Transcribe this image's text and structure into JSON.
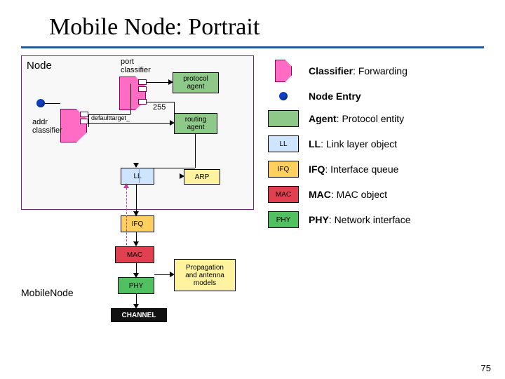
{
  "title": "Mobile Node: Portrait",
  "page_number": "75",
  "diagram": {
    "node_label": "Node",
    "port_classifier_label": "port\nclassifier",
    "protocol_agent": "protocol\nagent",
    "addr_classifier_label": "addr\nclassifier",
    "default_target": "defaulttarget_",
    "routing_agent": "routing\nagent",
    "num255": "255",
    "ll": "LL",
    "arp": "ARP",
    "ifq": "IFQ",
    "mac": "MAC",
    "phy": "PHY",
    "mobilenode": "MobileNode",
    "channel": "CHANNEL",
    "propagation": "Propagation\nand antenna\nmodels"
  },
  "legend": {
    "classifier": {
      "term": "Classifier",
      "desc": ": Forwarding"
    },
    "entry": {
      "term": "Node Entry",
      "desc": ""
    },
    "agent": {
      "term": "Agent",
      "desc": ": Protocol entity"
    },
    "ll": {
      "icon": "LL",
      "term": "LL",
      "desc": ": Link layer object"
    },
    "ifq": {
      "icon": "IFQ",
      "term": "IFQ",
      "desc": ": Interface queue"
    },
    "mac": {
      "icon": "MAC",
      "term": "MAC",
      "desc": ": MAC object"
    },
    "phy": {
      "icon": "PHY",
      "term": "PHY",
      "desc": ": Network interface"
    }
  }
}
